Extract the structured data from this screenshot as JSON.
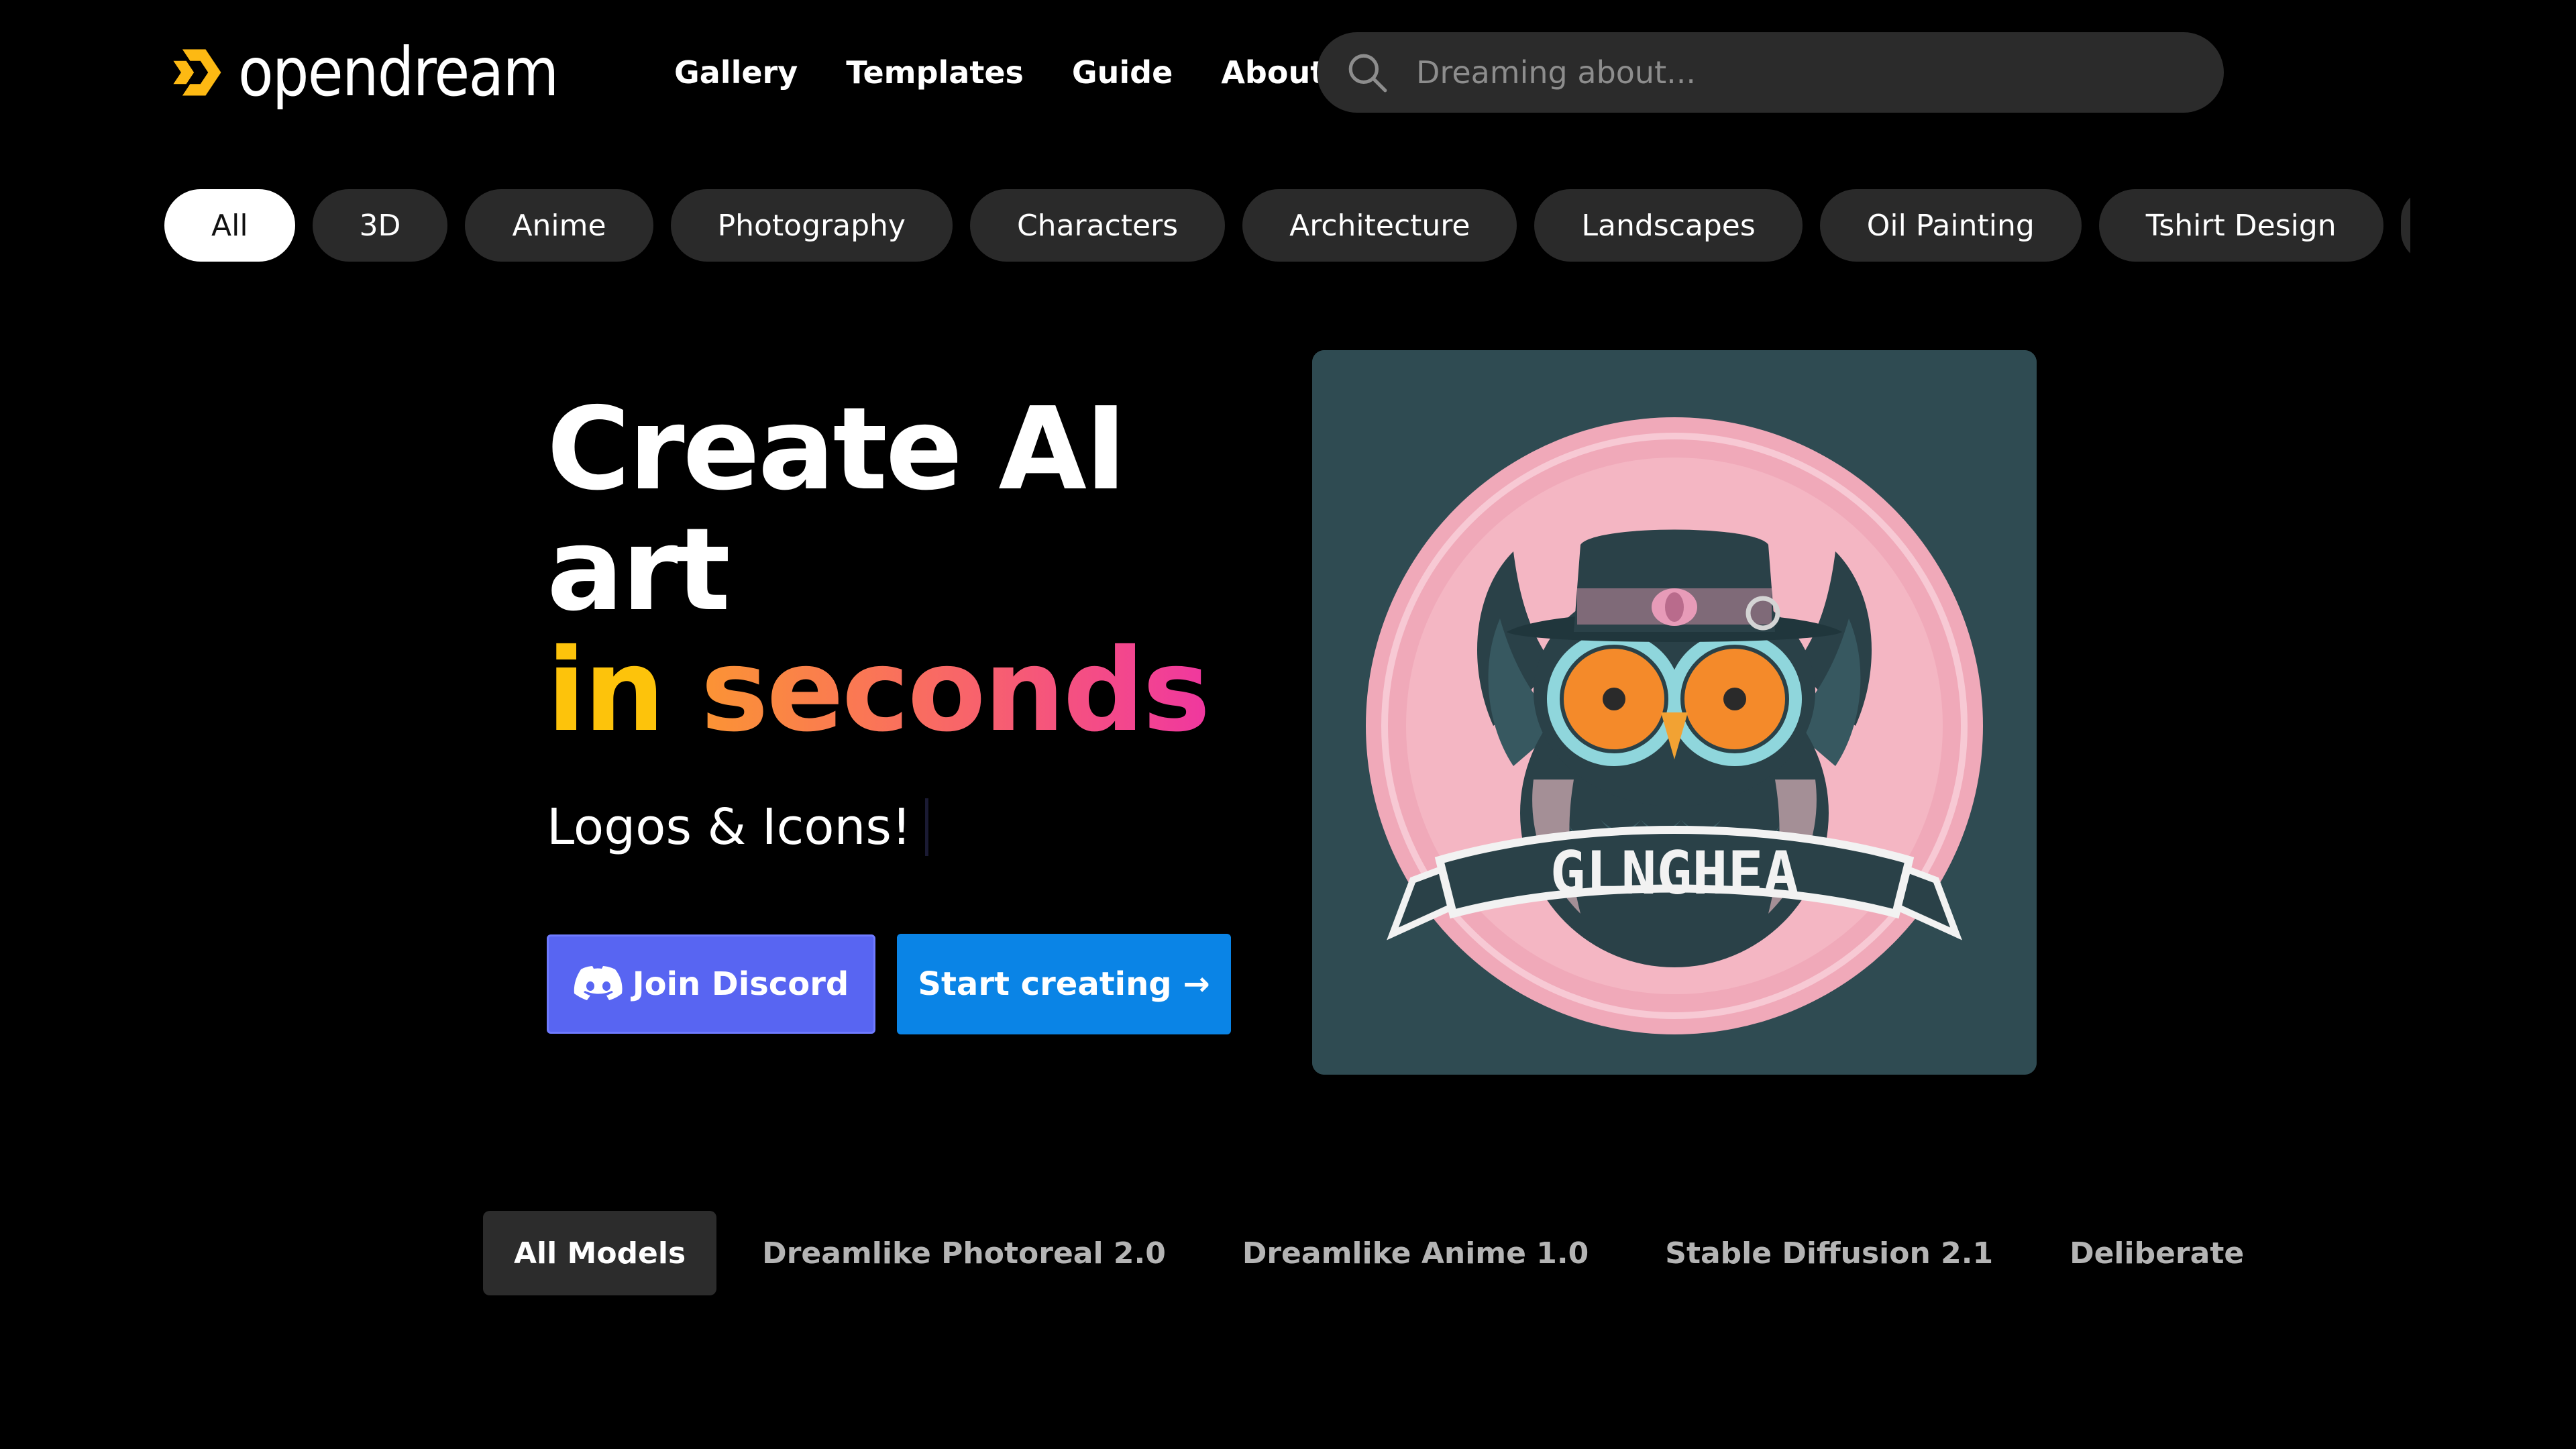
{
  "brand": {
    "name": "opendream",
    "logo_color": "#fdb913"
  },
  "nav": {
    "items": [
      "Gallery",
      "Templates",
      "Guide",
      "About"
    ]
  },
  "search": {
    "placeholder": "Dreaming about..."
  },
  "categories": {
    "items": [
      "All",
      "3D",
      "Anime",
      "Photography",
      "Characters",
      "Architecture",
      "Landscapes",
      "Oil Painting",
      "Tshirt Design"
    ],
    "active": "All"
  },
  "hero": {
    "title_line1": "Create AI",
    "title_line2": "art",
    "title_in": "in",
    "title_seconds": "seconds",
    "subtitle": "Logos & Icons!",
    "discord_label": "Join Discord",
    "start_label": "Start creating →",
    "gradient_colors": [
      "#fdc30b",
      "#fb9434",
      "#f0379f"
    ]
  },
  "artwork": {
    "banner_text": "GLNGHEA",
    "icon": "owl-logo-image"
  },
  "models": {
    "items": [
      "All Models",
      "Dreamlike Photoreal 2.0",
      "Dreamlike Anime 1.0",
      "Stable Diffusion 2.1",
      "Deliberate"
    ],
    "active": "All Models"
  },
  "colors": {
    "background": "#000000",
    "chip": "#2a2a2a",
    "discord": "#5865f2",
    "primary": "#0a84e6"
  }
}
